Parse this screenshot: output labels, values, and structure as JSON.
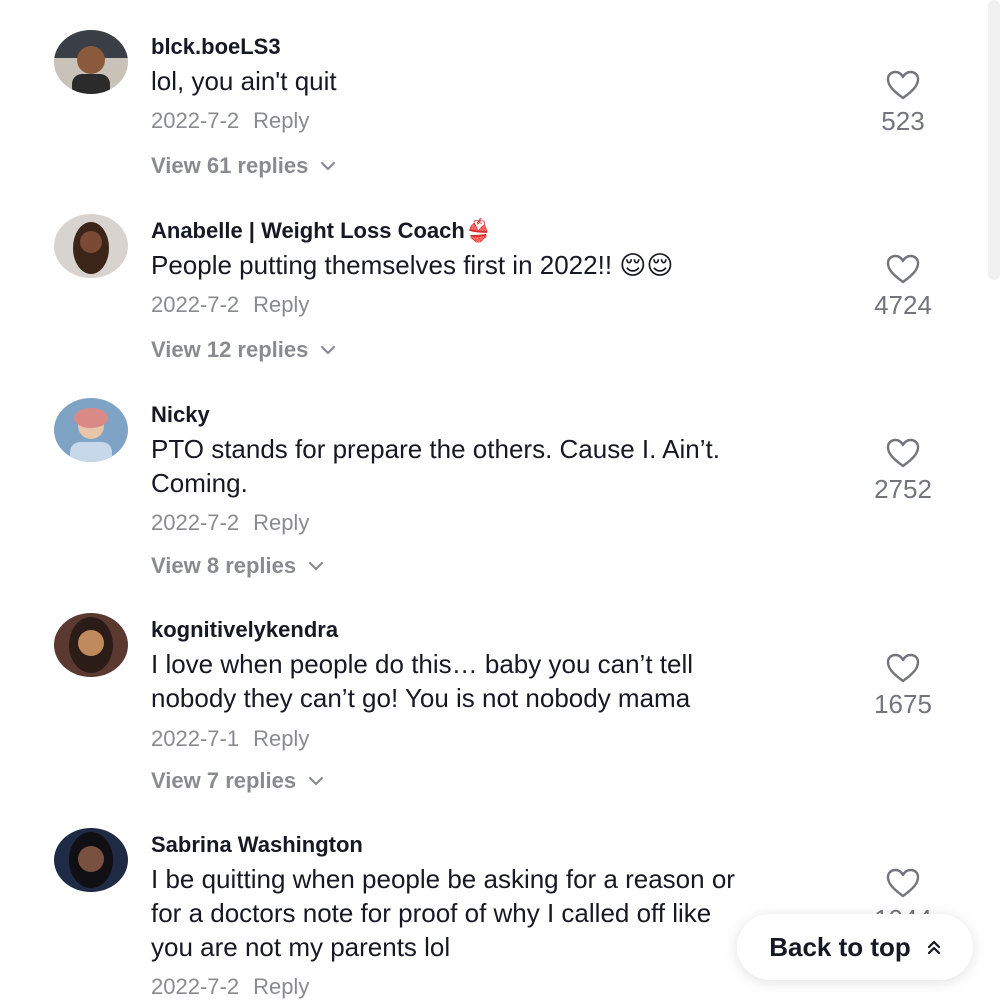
{
  "comments": [
    {
      "username": "blck.boeLS3",
      "lines": [
        "lol, you ain't quit"
      ],
      "date": "2022-7-2",
      "reply_label": "Reply",
      "likes": "523",
      "view_replies": "View 61 replies",
      "avatar_colors": [
        "#3a3f45",
        "#8b5a3c",
        "#c9c2b8"
      ]
    },
    {
      "username": "Anabelle | Weight Loss Coach👙",
      "lines": [
        "People putting themselves first in 2022!! 😌😌"
      ],
      "date": "2022-7-2",
      "reply_label": "Reply",
      "likes": "4724",
      "view_replies": "View 12 replies",
      "avatar_colors": [
        "#d9d3cf",
        "#3b2418",
        "#7a4a35"
      ]
    },
    {
      "username": "Nicky",
      "lines": [
        "PTO stands for prepare the others. Cause I. Ain’t.",
        "Coming."
      ],
      "date": "2022-7-2",
      "reply_label": "Reply",
      "likes": "2752",
      "view_replies": "View 8 replies",
      "avatar_colors": [
        "#7fa3c4",
        "#e8c4a8",
        "#d98a86"
      ]
    },
    {
      "username": "kognitivelykendra",
      "lines": [
        "I love when people do this… baby you can’t tell",
        "nobody they can’t go! You is not nobody mama"
      ],
      "date": "2022-7-1",
      "reply_label": "Reply",
      "likes": "1675",
      "view_replies": "View 7 replies",
      "avatar_colors": [
        "#5a3a30",
        "#c08a5c",
        "#2c1c18"
      ]
    },
    {
      "username": "Sabrina Washington",
      "lines": [
        "I be quitting when people be asking for a reason or",
        "for a doctors note for proof of why I called off  like",
        "you are not my parents lol"
      ],
      "date": "2022-7-2",
      "reply_label": "Reply",
      "likes": "1044",
      "avatar_colors": [
        "#1f2a44",
        "#7a5040",
        "#0f0f14"
      ]
    }
  ],
  "back_to_top": {
    "label": "Back to top",
    "icon": "double-chevron-up-icon"
  }
}
